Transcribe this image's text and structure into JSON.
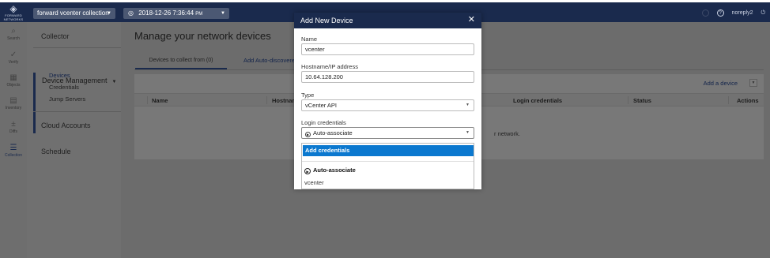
{
  "topbar": {
    "logo_text": "FORWARD NETWORKS",
    "collection": "forward vcenter collection",
    "snapshot_time": "2018-12-26 7:36:44",
    "snapshot_ampm": "PM",
    "help": "?",
    "user": "noreply2",
    "power": "⏻"
  },
  "rail": {
    "items": [
      {
        "label": "Search",
        "icon": "search-icon",
        "glyph": "⌕"
      },
      {
        "label": "Verify",
        "icon": "check-circle-icon",
        "glyph": "✓"
      },
      {
        "label": "Objects",
        "icon": "grid-icon",
        "glyph": "▦"
      },
      {
        "label": "Inventory",
        "icon": "inventory-icon",
        "glyph": "▤"
      },
      {
        "label": "Diffs",
        "icon": "diff-icon",
        "glyph": "±"
      },
      {
        "label": "Collection",
        "icon": "collection-icon",
        "glyph": "☰"
      }
    ]
  },
  "menu": {
    "collector": "Collector",
    "device_management": "Device Management",
    "sub_items": [
      "Devices",
      "Credentials",
      "Jump Servers"
    ],
    "cloud_accounts": "Cloud Accounts",
    "schedule": "Schedule"
  },
  "main": {
    "title": "Manage your network devices",
    "tab_devices": "Devices to collect from (0)",
    "tab_auto": "Add Auto-discovere",
    "add_device": "Add a device",
    "columns": [
      "Name",
      "Hostnam",
      "Login credentials",
      "Status",
      "Actions"
    ],
    "empty_text": "r network."
  },
  "modal": {
    "title": "Add New Device",
    "close": "✕",
    "name_label": "Name",
    "name_value": "vcenter",
    "host_label": "Hostname/IP address",
    "host_value": "10.64.128.200",
    "type_label": "Type",
    "type_value": "vCenter API",
    "login_label": "Login credentials",
    "login_value": "Auto-associate",
    "options": {
      "add_credentials": "Add credentials",
      "auto_associate": "Auto-associate",
      "vcenter": "vcenter"
    }
  },
  "colors": {
    "navy": "#1a2a4d",
    "accent_blue": "#0b78cf"
  }
}
